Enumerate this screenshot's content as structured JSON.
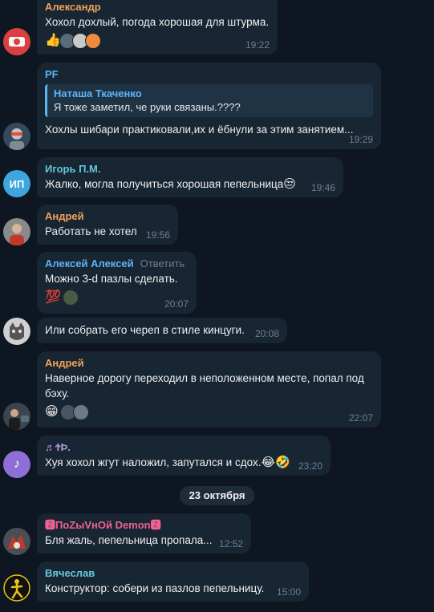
{
  "colors": {
    "background": "#0e1621",
    "bubble": "#182533",
    "timestamp": "#6d7f8f",
    "name_orange": "#f4a259",
    "name_blue": "#5eb5f7",
    "name_teal": "#65c7d9",
    "name_pink": "#f06292"
  },
  "messages": [
    {
      "sender": "Александр",
      "text": "Хохол дохлый, погода хорошая для штурма.",
      "time": "19:22",
      "reactions": [
        "👍"
      ]
    },
    {
      "sender": "PF",
      "reply_author": "Наташа Ткаченко",
      "reply_text": "Я тоже заметил, че руки связаны.????",
      "text": "Хохлы шибари практиковали,их и ёбнули за этим занятием...",
      "time": "19:29"
    },
    {
      "sender": "Игорь П.М.",
      "avatar_initials": "ИП",
      "text": "Жалко, могла получиться хорошая пепельница",
      "emoji": "😒",
      "time": "19:46"
    },
    {
      "sender": "Андрей",
      "text": "Работать не хотел",
      "time": "19:56"
    },
    {
      "sender": "Алексей Алексей",
      "action": "Ответить",
      "text": "Можно 3-d  пазлы сделать.",
      "time": "20:07",
      "reactions": [
        "💯"
      ]
    },
    {
      "text": "Или собрать его череп в стиле кинцуги.",
      "time": "20:08"
    },
    {
      "sender": "Андрей",
      "text_line1": "Наверное дорогу переходил в неположенном месте, попал под",
      "text_line2": "бэху.",
      "time": "22:07",
      "reactions": [
        "😁"
      ]
    },
    {
      "sender": "♬ϮÞ.",
      "text": "Хуя хохол жгут наложил, запутался и сдох.",
      "emoji": "😂🤣",
      "time": "23:20"
    },
    {
      "sender": "🆉ПоZыVнОй Demon🆉",
      "text": "Бля жаль, пепельница пропала...",
      "time": "12:52"
    },
    {
      "sender": "Вячеслав",
      "text": "Конструктор: собери из пазлов пепельницу.",
      "time": "15:00"
    }
  ],
  "date_separator": "23 октября"
}
